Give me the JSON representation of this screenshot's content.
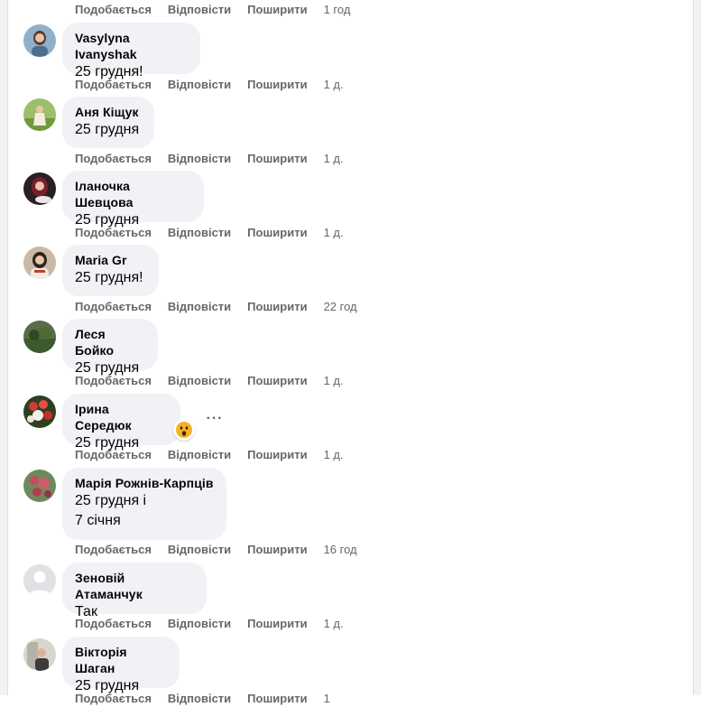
{
  "actions": {
    "like": "Подобається",
    "reply": "Відповісти",
    "share": "Поширити"
  },
  "comments": [
    {
      "name": "",
      "lines": [],
      "time": "1 год"
    },
    {
      "name": "Vasylyna Ivanyshak",
      "lines": [
        "25 грудня!"
      ],
      "time": "1 д."
    },
    {
      "name": "Аня Кіщук",
      "lines": [
        "25 грудня"
      ],
      "time": "1 д."
    },
    {
      "name": "Іланочка Шевцова",
      "lines": [
        "25 грудня"
      ],
      "time": "1 д."
    },
    {
      "name": "Maria Gr",
      "lines": [
        "25 грудня!"
      ],
      "time": "22 год"
    },
    {
      "name": "Леся Бойко",
      "lines": [
        "25 грудня"
      ],
      "time": "1 д."
    },
    {
      "name": "Ірина Середюк",
      "lines": [
        "25 грудня"
      ],
      "time": "1 д.",
      "reaction": "wow",
      "more": "···"
    },
    {
      "name": "Марія Рожнів-Карпців",
      "lines": [
        "25 грудня і",
        "7 січня"
      ],
      "time": "16 год"
    },
    {
      "name": "Зеновій Атаманчук",
      "lines": [
        "Так"
      ],
      "time": "1 д."
    },
    {
      "name": "Вікторія Шаган",
      "lines": [
        "25 грудня"
      ],
      "time": "1"
    }
  ],
  "colors": {
    "bubble": "#f0f2f5",
    "meta": "#65676b",
    "text": "#050505",
    "reaction_wow": "#f7b125"
  }
}
